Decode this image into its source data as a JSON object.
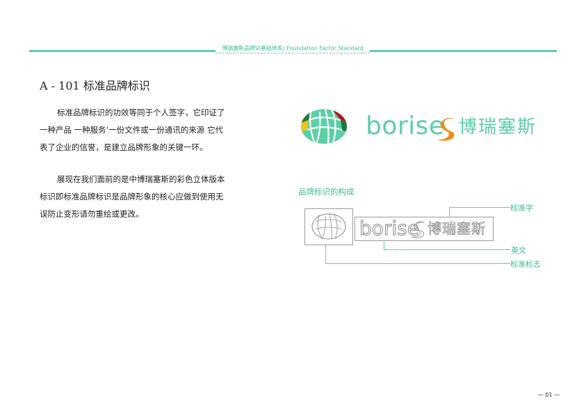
{
  "header": {
    "text": "博瑞塞斯品牌VI基础体系| Foundation  Factor  Standard"
  },
  "title": "A - 101 标准品牌标识",
  "paragraph1": [
    "标准品牌标识的功效等同于个人签字，它印证了",
    "一种产品 一种服务‘一份文件或一份通讯的来源 它代",
    "表了企业的信誉，是建立品牌形象的关键一环。"
  ],
  "paragraph2": [
    "展现在我们面前的是中博瑞塞斯的彩色立体版本",
    "标识即标准品牌标识是品牌形象的核心应做到使用无",
    "误防止变形请勿重绘或更改。"
  ],
  "logo": {
    "english": "borise",
    "chinese": "博瑞塞斯",
    "symbol_icon": "globe-segment-icon",
    "colors": {
      "green": "#5ccfa6",
      "dark_green": "#1f7a3a",
      "red": "#b3151b",
      "yellow": "#f2c41b",
      "orange": "#f28a1a"
    }
  },
  "composition": {
    "label": "品牌标识的构成",
    "callouts": {
      "standard_text": "标准字",
      "english": "英文",
      "standard_mark": "标准标志"
    }
  },
  "page_number": "— 01 —"
}
